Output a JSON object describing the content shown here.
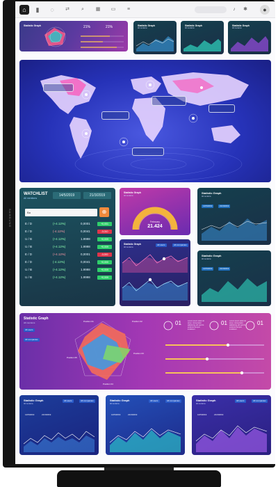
{
  "monitor": {
    "brand": "SAMSUNG"
  },
  "topbar": {
    "icons": [
      "home-icon",
      "bar-chart-icon",
      "chat-icon",
      "shuffle-icon",
      "search-icon",
      "calendar-icon",
      "wallet-icon",
      "menu-icon",
      "bell-icon",
      "settings-icon",
      "user-icon"
    ]
  },
  "top_row": {
    "radar_stats": [
      "21%",
      "21%"
    ]
  },
  "mini_cards": [
    {
      "title": "Statistic Graph",
      "sub": "All mentions"
    },
    {
      "title": "Statistic Graph",
      "sub": "All mentions"
    },
    {
      "title": "Statistic Graph",
      "sub": "All mentions"
    }
  ],
  "watchlist": {
    "title": "WATCHLIST",
    "subtitle": "All mentions",
    "date_from": "14/5/2019",
    "date_to": "21/3/2019",
    "search_value": "Ba",
    "rows": [
      {
        "pair": "E / D",
        "change": "(+4.12%)",
        "price": "0,0001",
        "delta": "+0,001",
        "dir": "up"
      },
      {
        "pair": "E / D",
        "change": "(-4.12%)",
        "price": "0,0041",
        "delta": "-0,010",
        "dir": "down"
      },
      {
        "pair": "U / B",
        "change": "(+4.12%)",
        "price": "1.9998",
        "delta": "+0,009",
        "dir": "up"
      },
      {
        "pair": "U / B",
        "change": "(+4.12%)",
        "price": "1.9998",
        "delta": "+0,009",
        "dir": "up"
      },
      {
        "pair": "E / D",
        "change": "(+4.12%)",
        "price": "0,0001",
        "delta": "-0,000",
        "dir": "down"
      },
      {
        "pair": "E / D",
        "change": "(-4.12%)",
        "price": "0,0041",
        "delta": "+0,000",
        "dir": "up"
      },
      {
        "pair": "U / B",
        "change": "(+4.12%)",
        "price": "1.9998",
        "delta": "+0,009",
        "dir": "up"
      },
      {
        "pair": "U / B",
        "change": "(+4.12%)",
        "price": "1.9998",
        "delta": "+0,009",
        "dir": "up"
      }
    ]
  },
  "gauge": {
    "title": "Statistic Graph",
    "sub": "All mentions",
    "label": "February",
    "value": "21.424"
  },
  "stat_graphs": [
    {
      "title": "Statistic Graph",
      "sub": "All mentions",
      "d1": "14/5/2019",
      "d2": "21/3/2019"
    },
    {
      "title": "Statistic Graph",
      "sub": "All mentions",
      "d1": "14/5/2019",
      "d2": "21/3/2019"
    },
    {
      "title": "Statistic Graph",
      "sub": "All mentions"
    }
  ],
  "radar_panel": {
    "title": "Statistic Graph",
    "sub": "All mentions",
    "dropdowns": [
      "All users",
      "All companies"
    ],
    "labels": [
      "Position 01",
      "Position 02",
      "Position 03",
      "Position 04",
      "Position 05"
    ],
    "stats": [
      "01",
      "01",
      "01"
    ],
    "stat_text": "Lorem ipsum dolor sit amet, consectetur adipiscing elit sed do eiusmod tempor incididunt"
  },
  "bottom_cards": [
    {
      "title": "Statistic Graph",
      "sub": "All mentions",
      "d1": "14/5/2019",
      "d2": "21/3/2019"
    },
    {
      "title": "Statistic Graph",
      "sub": "All mentions",
      "d1": "14/5/2019",
      "d2": "21/3/2019"
    },
    {
      "title": "Statistic Graph",
      "sub": "All mentions",
      "d1": "14/5/2019",
      "d2": "21/3/2019"
    }
  ],
  "colors": {
    "up": "#2fcf6a",
    "down": "#e0344a",
    "map_bg": "#2a36c8",
    "gauge_arc": "#f3b33d"
  }
}
